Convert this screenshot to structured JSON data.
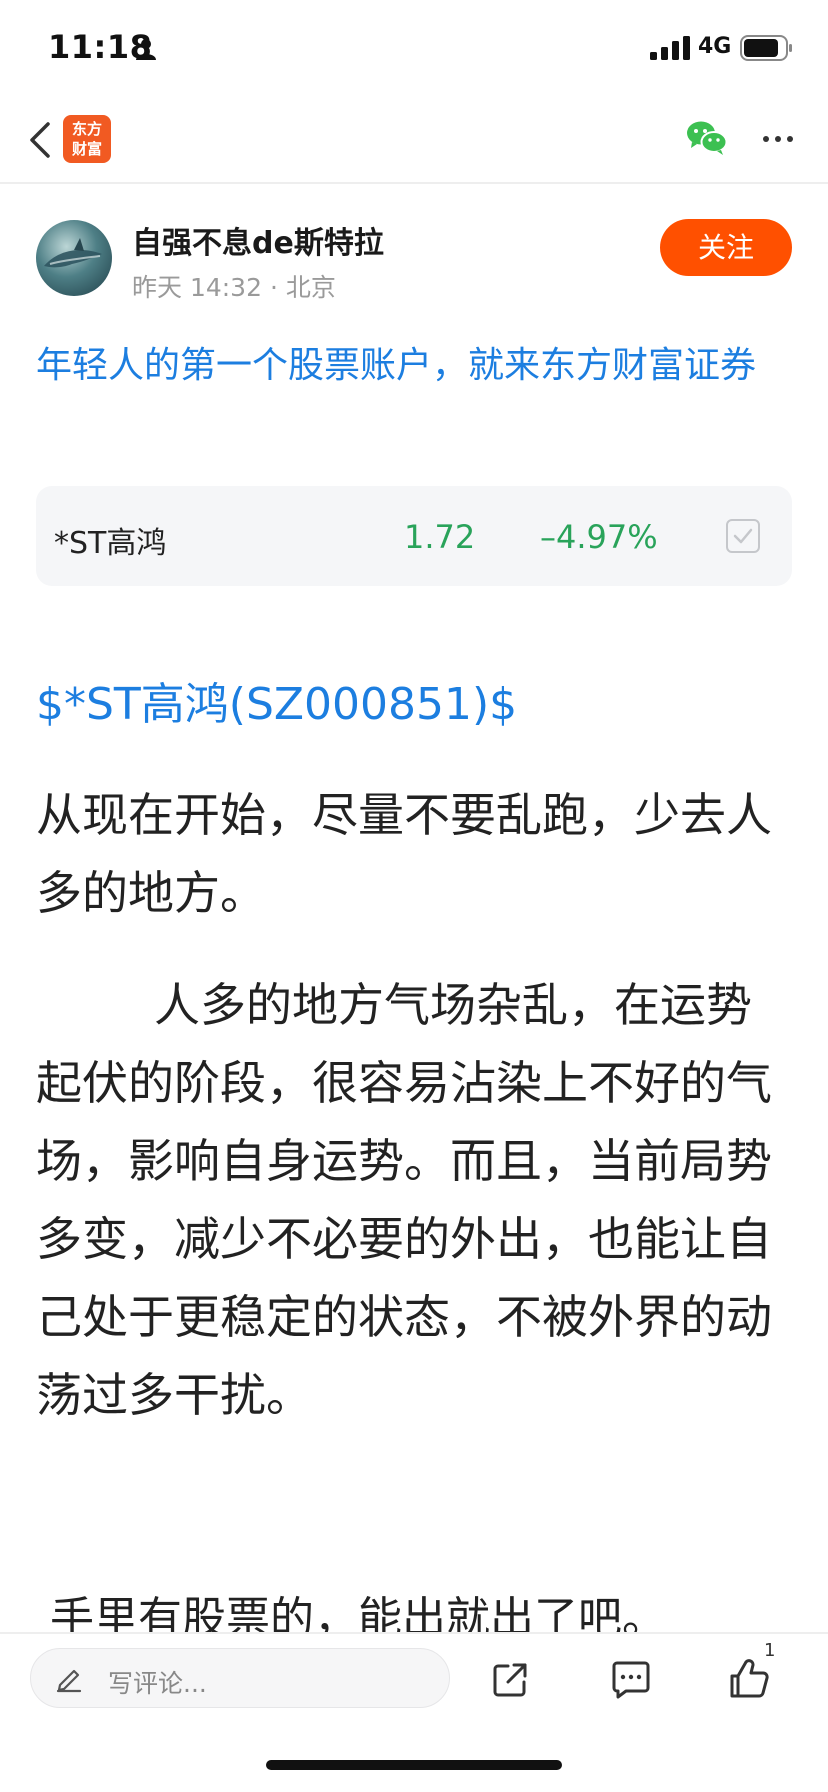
{
  "status_bar": {
    "time": "11:18",
    "network": "4G",
    "icons": [
      "person-icon",
      "signal-icon",
      "battery-icon"
    ]
  },
  "nav": {
    "logo_line1": "东方",
    "logo_line2": "财富",
    "icons": [
      "back-icon",
      "wechat-icon",
      "more-icon"
    ]
  },
  "author": {
    "name": "自强不息de斯特拉",
    "meta": "昨天 14:32 · 北京",
    "follow_label": "关注"
  },
  "promo": {
    "text": "年轻人的第一个股票账户，就来东方财富证券"
  },
  "stock": {
    "name": "*ST高鸿",
    "price": "1.72",
    "change": "–4.97%",
    "color": "#29a35a"
  },
  "post": {
    "ticker": "$*ST高鸿(SZ000851)$",
    "paragraph1": "从现在开始，尽量不要乱跑，少去人多的地方。",
    "paragraph2": "人多的地方气场杂乱，在运势起伏的阶段，很容易沾染上不好的气场，影响自身运势。而且，当前局势多变，减少不必要的外出，也能让自己处于更稳定的状态，不被外界的动荡过多干扰。",
    "paragraph3": "手里有股票的，能出就出了吧。"
  },
  "bottom": {
    "comment_placeholder": "写评论...",
    "like_count": "1",
    "icons": [
      "pencil-icon",
      "share-icon",
      "comment-icon",
      "like-icon"
    ]
  },
  "colors": {
    "accent_orange": "#ff5000",
    "link_blue": "#1c7ee0"
  }
}
